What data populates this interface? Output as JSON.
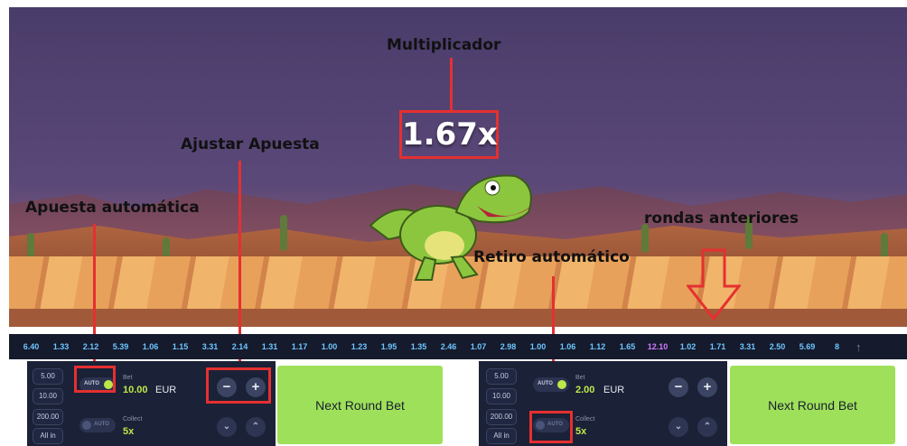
{
  "annotations": {
    "multiplicador": "Multiplicador",
    "ajustar_apuesta": "Ajustar Apuesta",
    "apuesta_automatica": "Apuesta automática",
    "rondas_anteriores": "rondas anteriores",
    "retiro_automatico": "Retiro automático"
  },
  "game": {
    "multiplier": "1.67x"
  },
  "history": [
    "6.40",
    "1.33",
    "2.12",
    "5.39",
    "1.06",
    "1.15",
    "3.31",
    "2.14",
    "1.31",
    "1.17",
    "1.00",
    "1.23",
    "1.95",
    "1.35",
    "2.46",
    "1.07",
    "2.98",
    "1.00",
    "1.06",
    "1.12",
    "1.65",
    "12.10",
    "1.02",
    "1.71",
    "3.31",
    "2.50",
    "5.69",
    "8"
  ],
  "history_highlight_value": "12.10",
  "panels": [
    {
      "amounts": [
        "5.00",
        "10.00",
        "200.00",
        "All in"
      ],
      "auto_label": "AUTO",
      "bet_label": "Bet",
      "bet_value": "10.00",
      "currency": "EUR",
      "collect_label": "Collect",
      "collect_value": "5x",
      "button_label": "Next Round Bet"
    },
    {
      "amounts": [
        "5.00",
        "10.00",
        "200.00",
        "All in"
      ],
      "auto_label": "AUTO",
      "bet_label": "Bet",
      "bet_value": "2.00",
      "currency": "EUR",
      "collect_label": "Collect",
      "collect_value": "5x",
      "button_label": "Next Round Bet"
    }
  ],
  "colors": {
    "accent_green": "#bde84a",
    "button_green": "#9fe05a",
    "annotation_red": "#e53030",
    "history_blue": "#6ec6ff",
    "history_purple": "#d07cff"
  }
}
